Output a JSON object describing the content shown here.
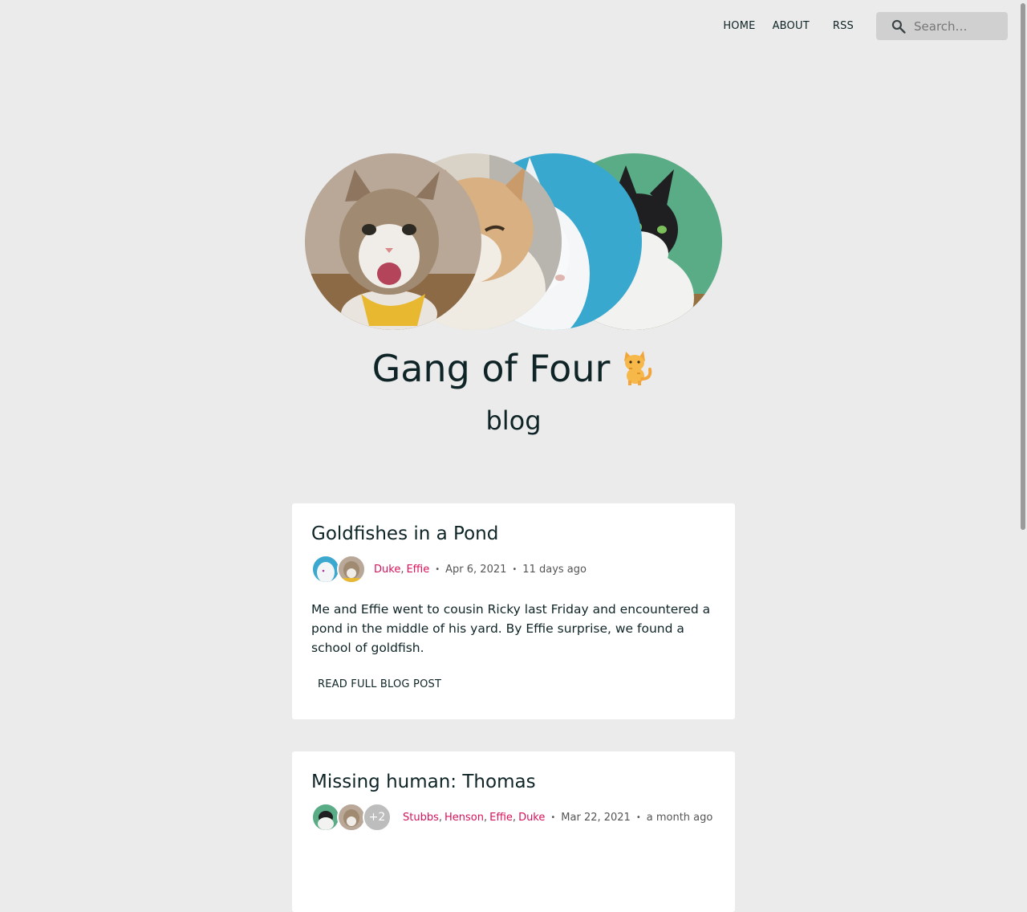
{
  "nav": {
    "home": "HOME",
    "about": "ABOUT",
    "rss": "RSS",
    "search_placeholder": "Search…"
  },
  "hero": {
    "title": "Gang of Four",
    "title_emoji": "cat-emoji",
    "subtitle": "blog"
  },
  "colors": {
    "background": "#ebebeb",
    "text": "#0f2426",
    "author_link": "#d6125a",
    "card": "#ffffff"
  },
  "posts": [
    {
      "title": "Goldfishes in a Pond",
      "authors": [
        "Duke",
        "Effie"
      ],
      "date": "Apr 6, 2021",
      "relative": "11 days ago",
      "excerpt": "Me and Effie went to cousin Ricky last Friday and encountered a pond in the middle of his yard. By Effie surprise, we found a school of goldfish.",
      "read_more": "READ FULL BLOG POST"
    },
    {
      "title": "Missing human: Thomas",
      "authors": [
        "Stubbs",
        "Henson",
        "Effie",
        "Duke"
      ],
      "extra_avatars": "+2",
      "date": "Mar 22, 2021",
      "relative": "a month ago"
    }
  ]
}
